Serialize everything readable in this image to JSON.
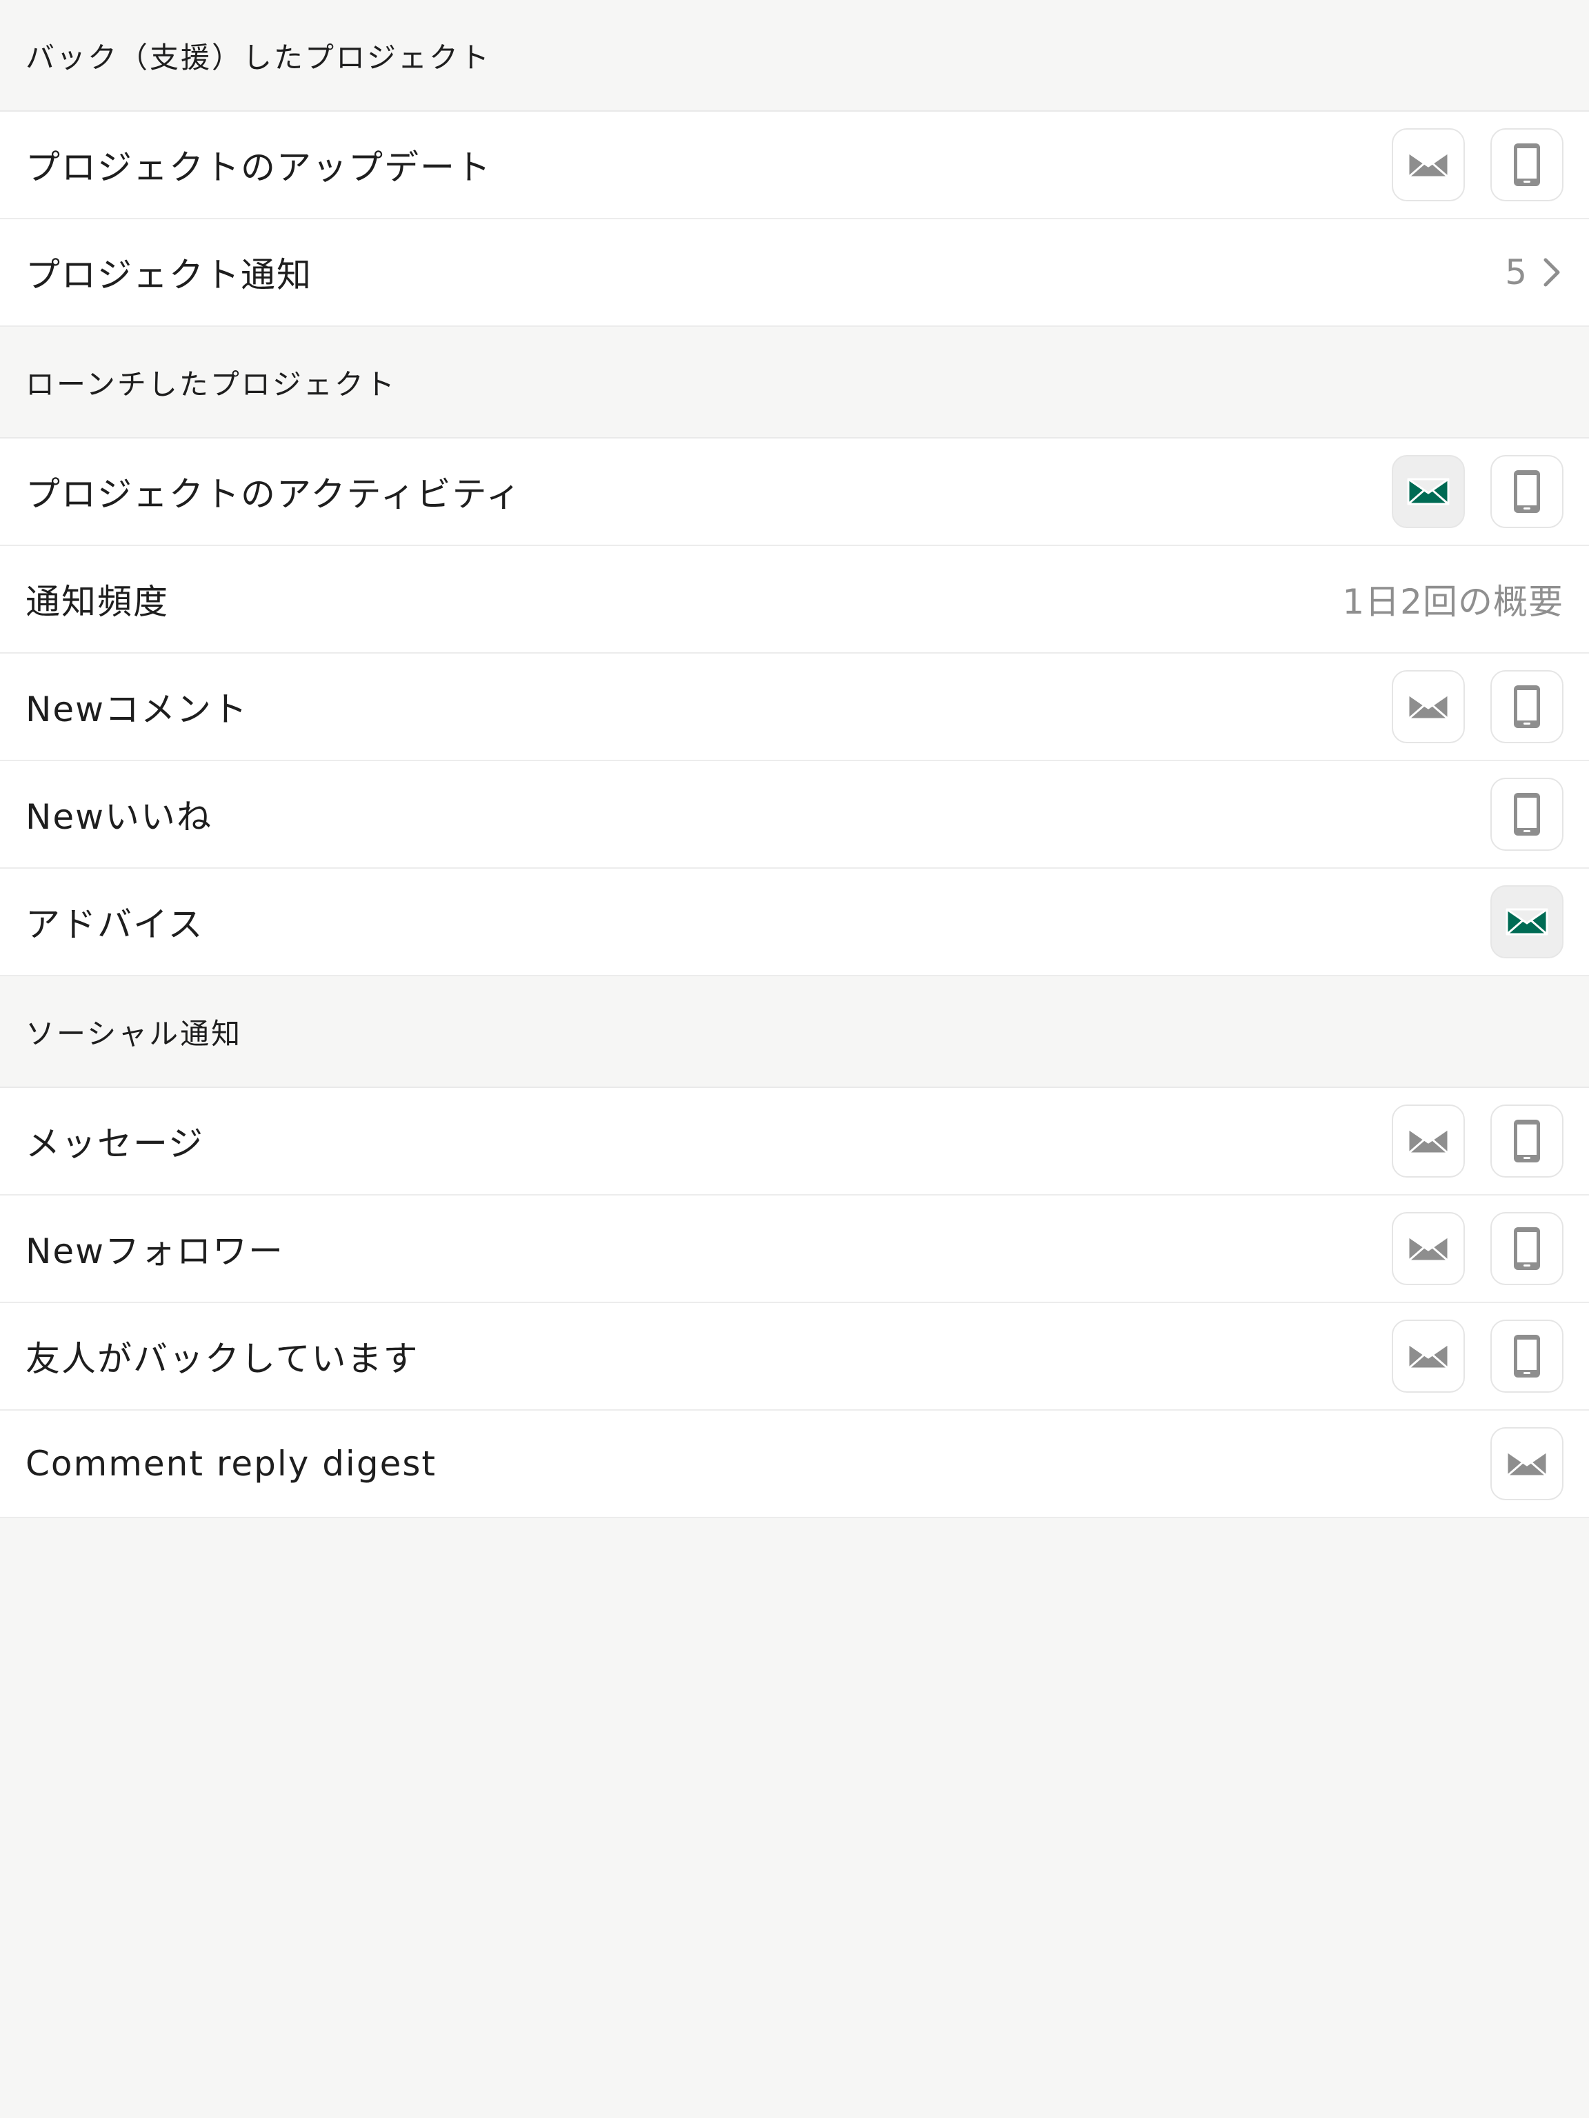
{
  "colors": {
    "background": "#f6f6f5",
    "row": "#ffffff",
    "active_accent": "#006b54",
    "icon_gray": "#8e8e8e",
    "secondary_text": "#8f8f8f"
  },
  "sections": [
    {
      "header": "バック（支援）したプロジェクト",
      "rows": [
        {
          "label": "プロジェクトのアップデート",
          "email": "off",
          "mobile": "off"
        },
        {
          "label": "プロジェクト通知",
          "count": "5",
          "icon": "chevron-right-icon"
        }
      ]
    },
    {
      "header": "ローンチしたプロジェクト",
      "rows": [
        {
          "label": "プロジェクトのアクティビティ",
          "email": "on",
          "mobile": "off"
        },
        {
          "label": "通知頻度",
          "value": "1日2回の概要"
        },
        {
          "label": "Newコメント",
          "email": "off",
          "mobile": "off"
        },
        {
          "label": "Newいいね",
          "mobile": "off"
        },
        {
          "label": "アドバイス",
          "email": "on"
        }
      ]
    },
    {
      "header": "ソーシャル通知",
      "rows": [
        {
          "label": "メッセージ",
          "email": "off",
          "mobile": "off"
        },
        {
          "label": "Newフォロワー",
          "email": "off",
          "mobile": "off"
        },
        {
          "label": "友人がバックしています",
          "email": "off",
          "mobile": "off"
        },
        {
          "label": "Comment reply digest",
          "email": "off"
        }
      ]
    }
  ]
}
